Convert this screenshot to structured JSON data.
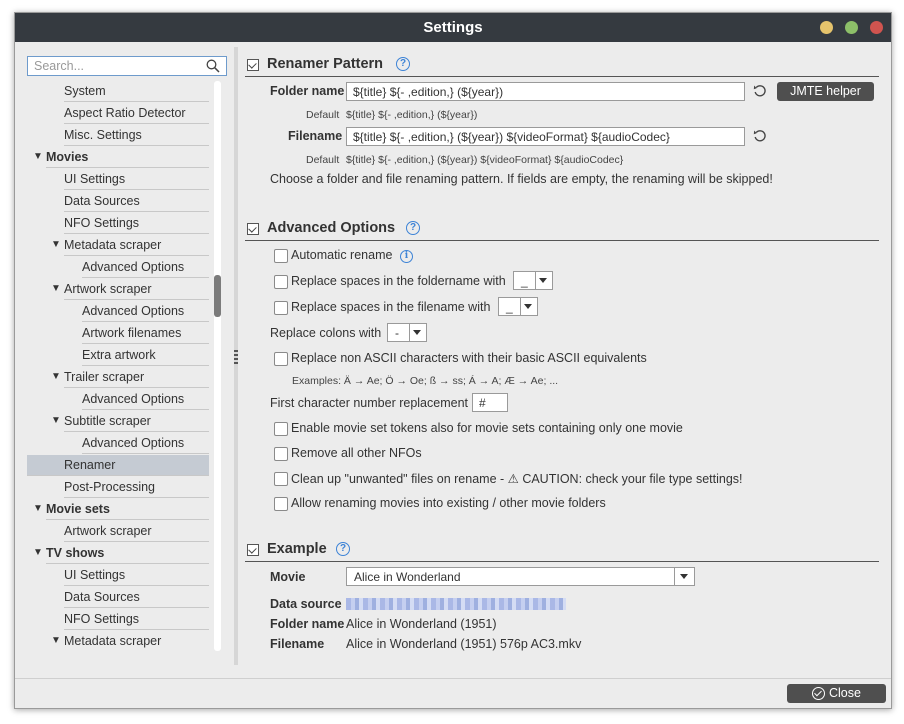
{
  "window": {
    "title": "Settings"
  },
  "search": {
    "placeholder": "Search..."
  },
  "tree": [
    {
      "label": "System",
      "level": 2,
      "expanded": null
    },
    {
      "label": "Aspect Ratio Detector",
      "level": 2,
      "expanded": null
    },
    {
      "label": "Misc. Settings",
      "level": 2,
      "expanded": null
    },
    {
      "label": "Movies",
      "level": 1,
      "expanded": true
    },
    {
      "label": "UI Settings",
      "level": 2,
      "expanded": null
    },
    {
      "label": "Data Sources",
      "level": 2,
      "expanded": null
    },
    {
      "label": "NFO Settings",
      "level": 2,
      "expanded": null
    },
    {
      "label": "Metadata scraper",
      "level": 2,
      "expanded": true
    },
    {
      "label": "Advanced Options",
      "level": 3,
      "expanded": null
    },
    {
      "label": "Artwork scraper",
      "level": 2,
      "expanded": true
    },
    {
      "label": "Advanced Options",
      "level": 3,
      "expanded": null
    },
    {
      "label": "Artwork filenames",
      "level": 3,
      "expanded": null
    },
    {
      "label": "Extra artwork",
      "level": 3,
      "expanded": null
    },
    {
      "label": "Trailer scraper",
      "level": 2,
      "expanded": true
    },
    {
      "label": "Advanced Options",
      "level": 3,
      "expanded": null
    },
    {
      "label": "Subtitle scraper",
      "level": 2,
      "expanded": true
    },
    {
      "label": "Advanced Options",
      "level": 3,
      "expanded": null
    },
    {
      "label": "Renamer",
      "level": 2,
      "expanded": null,
      "selected": true
    },
    {
      "label": "Post-Processing",
      "level": 2,
      "expanded": null
    },
    {
      "label": "Movie sets",
      "level": 1,
      "expanded": true
    },
    {
      "label": "Artwork scraper",
      "level": 2,
      "expanded": null
    },
    {
      "label": "TV shows",
      "level": 1,
      "expanded": true
    },
    {
      "label": "UI Settings",
      "level": 2,
      "expanded": null
    },
    {
      "label": "Data Sources",
      "level": 2,
      "expanded": null
    },
    {
      "label": "NFO Settings",
      "level": 2,
      "expanded": null
    },
    {
      "label": "Metadata scraper",
      "level": 2,
      "expanded": true
    }
  ],
  "renamer_pattern": {
    "title": "Renamer Pattern",
    "folder_label": "Folder name",
    "folder_value": "${title} ${- ,edition,} (${year})",
    "jmte_button": "JMTE helper",
    "default_label": "Default",
    "folder_default": "${title} ${- ,edition,} (${year})",
    "file_label": "Filename",
    "file_value": "${title} ${- ,edition,} (${year}) ${videoFormat} ${audioCodec}",
    "file_default": "${title} ${- ,edition,} (${year}) ${videoFormat} ${audioCodec}",
    "hint": "Choose a folder and file renaming pattern. If fields are empty, the renaming will be skipped!"
  },
  "advanced": {
    "title": "Advanced Options",
    "auto_rename": "Automatic rename",
    "spaces_folder": "Replace spaces in the foldername with",
    "spaces_folder_value": "_",
    "spaces_file": "Replace spaces in the filename with",
    "spaces_file_value": "_",
    "colons": "Replace colons with",
    "colons_value": "-",
    "ascii": "Replace non ASCII characters with their basic ASCII equivalents",
    "ascii_examples": "Examples: Ä → Ae; Ö → Oe; ß → ss; Á → A; Æ → Ae; ...",
    "first_char": "First character number replacement",
    "first_char_value": "#",
    "movie_set_tokens": "Enable movie set tokens also for movie sets containing only one movie",
    "remove_nfos": "Remove all other NFOs",
    "cleanup": "Clean up \"unwanted\" files on rename - ⚠ CAUTION: check your file type settings!",
    "allow_existing": "Allow renaming movies into existing / other movie folders"
  },
  "example": {
    "title": "Example",
    "movie_label": "Movie",
    "movie_value": "Alice in Wonderland",
    "datasource_label": "Data source",
    "folder_label": "Folder name",
    "folder_value": "Alice in Wonderland (1951)",
    "file_label": "Filename",
    "file_value": "Alice in Wonderland (1951) 576p AC3.mkv"
  },
  "footer": {
    "close_label": "Close"
  }
}
